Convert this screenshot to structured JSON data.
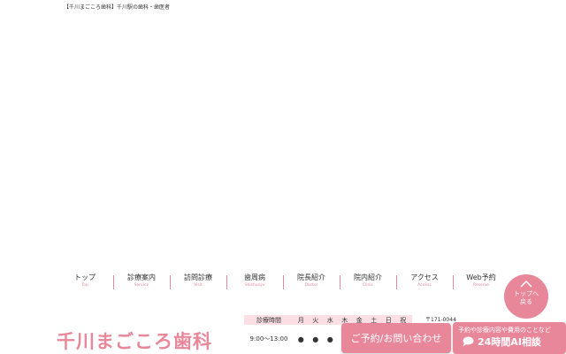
{
  "header": {
    "tagline": "【千川まごころ歯科】千川駅の歯科・歯医者"
  },
  "nav": {
    "items": [
      {
        "ja": "トップ",
        "en": "Top"
      },
      {
        "ja": "診療案内",
        "en": "Service"
      },
      {
        "ja": "訪問診療",
        "en": "Visit"
      },
      {
        "ja": "歯周病",
        "en": "Shishusyo"
      },
      {
        "ja": "院長紹介",
        "en": "Doctor"
      },
      {
        "ja": "院内紹介",
        "en": "Clinic"
      },
      {
        "ja": "アクセス",
        "en": "Access"
      },
      {
        "ja": "Web予約",
        "en": "Reserve"
      }
    ]
  },
  "logo": {
    "text": "千川まごころ歯科"
  },
  "hours": {
    "header_label": "診療時間",
    "days": [
      "月",
      "火",
      "水",
      "木",
      "金",
      "土",
      "日",
      "祝"
    ],
    "rows": [
      {
        "time": "9:00〜13:00",
        "marks": [
          "●",
          "●",
          "●",
          "／",
          "",
          "",
          "",
          ""
        ]
      }
    ]
  },
  "address": {
    "postal": "〒171-0044"
  },
  "cta": {
    "contact_label": "ご予約/お問い合わせ",
    "ai_sub": "予約や診療内容や費用のことなど",
    "ai_main": "24時間AI相談"
  },
  "back_to_top": {
    "label": "トップへ戻る"
  },
  "colors": {
    "accent": "#e8879a",
    "accent_light": "#fbdfe4"
  },
  "icons": {
    "chat": "chat-bubble-icon",
    "arrow": "chevron-up-icon"
  }
}
